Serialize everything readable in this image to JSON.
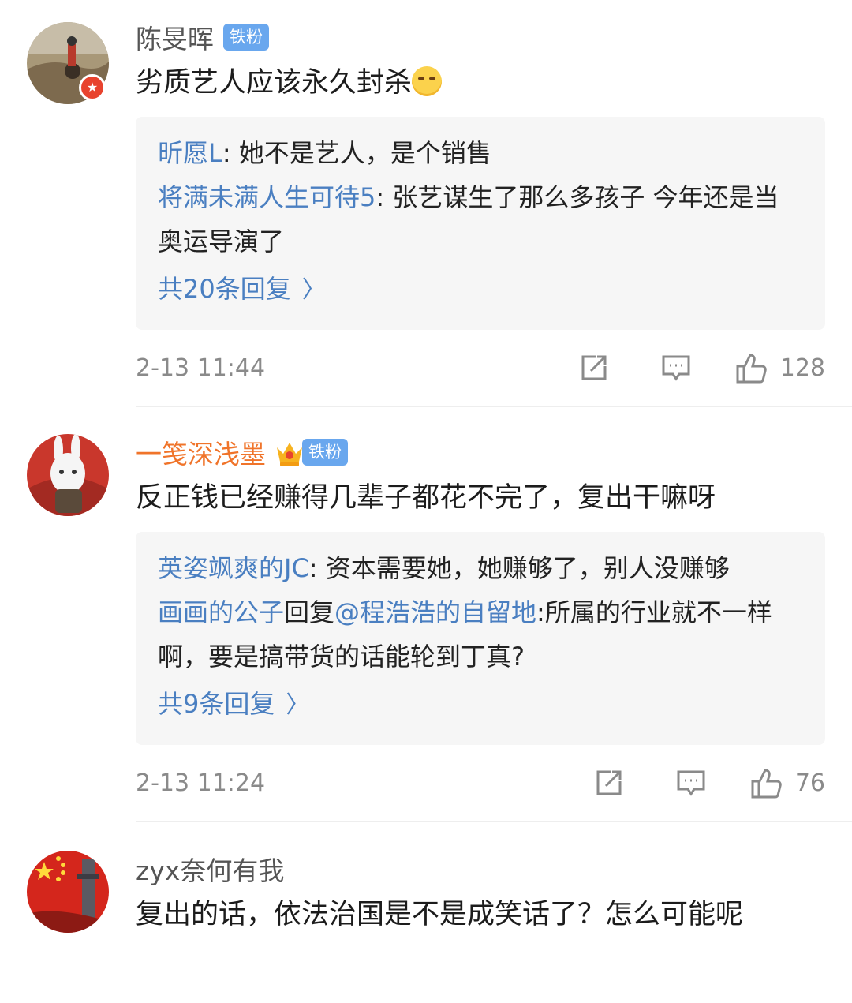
{
  "comments": [
    {
      "username": "陈旻晖",
      "fan_badge": "铁粉",
      "text": "劣质艺人应该永久封杀",
      "replies": [
        {
          "user": "昕愿L",
          "text": ": 她不是艺人，是个销售"
        },
        {
          "user": "将满未满人生可待5",
          "text": ": 张艺谋生了那么多孩子 今年还是当奥运导演了"
        }
      ],
      "more_replies": "共20条回复",
      "time": "2-13 11:44",
      "likes": "128"
    },
    {
      "username": "一笺深浅墨",
      "fan_badge": "铁粉",
      "text": "反正钱已经赚得几辈子都花不完了，复出干嘛呀",
      "replies": [
        {
          "user": "英姿飒爽的JC",
          "text": ": 资本需要她，她赚够了，别人没赚够"
        },
        {
          "user": "画画的公子",
          "mid": "回复",
          "mention": "@程浩浩的自留地",
          "text": ":所属的行业就不一样啊，要是搞带货的话能轮到丁真?"
        }
      ],
      "more_replies": "共9条回复",
      "time": "2-13 11:24",
      "likes": "76"
    },
    {
      "username": "zyx奈何有我",
      "text": "复出的话，依法治国是不是成笑话了？怎么可能呢"
    }
  ],
  "icons": {
    "repost": "repost-icon",
    "comment": "comment-icon",
    "like": "thumbs-up-icon",
    "more_chevron": "chevron-right-icon"
  },
  "colors": {
    "link_blue": "#4a7fc1",
    "vip_orange": "#f0742a",
    "fan_badge": "#69a7ee"
  }
}
